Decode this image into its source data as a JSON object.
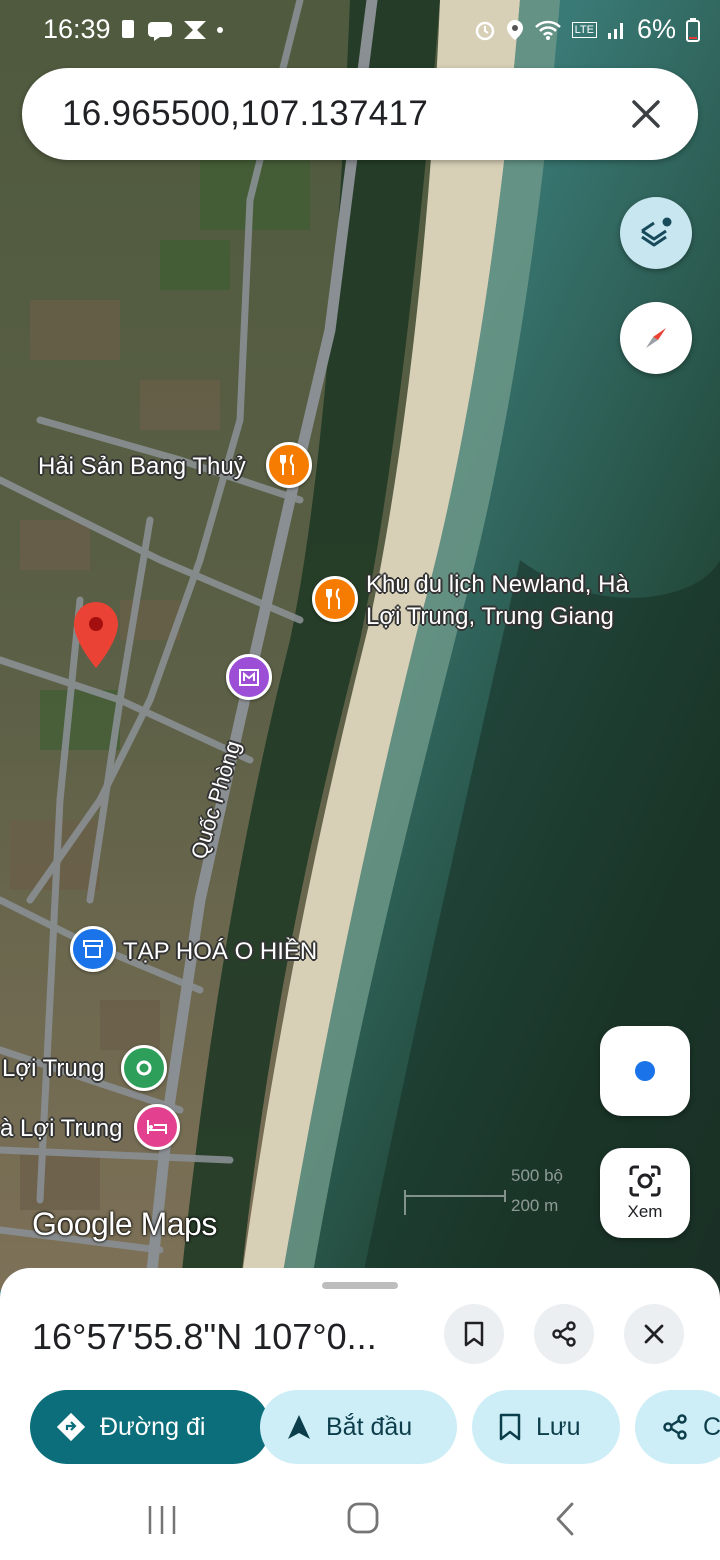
{
  "status_bar": {
    "time": "16:39",
    "network": "LTE",
    "battery": "6%"
  },
  "search": {
    "query": "16.965500,107.137417"
  },
  "map": {
    "labels": {
      "restaurant_1": "Hải Sản Bang Thuỷ",
      "resort_line1": "Khu du lịch Newland, Hà",
      "resort_line2": "Lợi Trung, Trung Giang",
      "road": "Quốc Phòng",
      "shop": "TẠP HOÁ O HIỀN",
      "place_1": "Lợi Trung",
      "place_2": "à Lợi Trung"
    },
    "watermark": "Google Maps",
    "scale_1": "500 bộ",
    "scale_2": "200 m"
  },
  "controls": {
    "view_label": "Xem"
  },
  "sheet": {
    "coordinates": "16°57'55.8\"N 107°0...",
    "actions": {
      "directions": "Đường đi",
      "start": "Bắt đầu",
      "save": "Lưu",
      "share": "C"
    }
  },
  "colors": {
    "primary_chip": "#0b6e7a",
    "secondary_chip": "#cdeef7",
    "pin_red": "#ea4335",
    "restaurant_orange": "#f57c00",
    "museum_purple": "#9c4fd6",
    "shop_blue": "#1a73e8",
    "place_green": "#2e9e5b",
    "hotel_pink": "#e3418f"
  }
}
